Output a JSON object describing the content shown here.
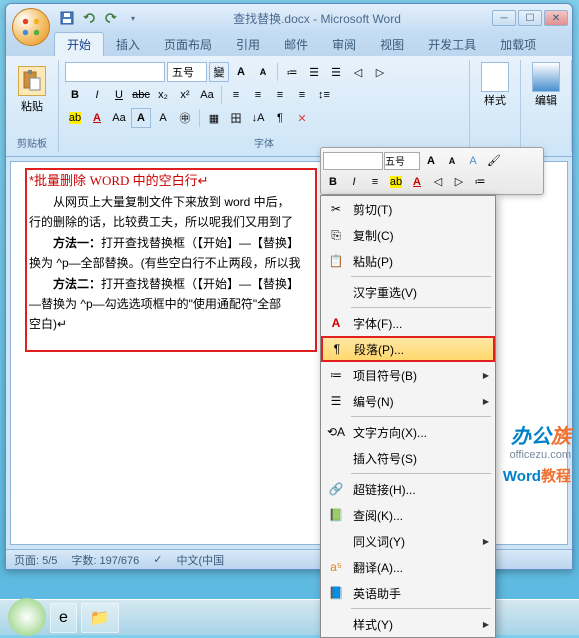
{
  "window": {
    "title": "查找替换.docx - Microsoft Word"
  },
  "tabs": {
    "t0": "开始",
    "t1": "插入",
    "t2": "页面布局",
    "t3": "引用",
    "t4": "邮件",
    "t5": "审阅",
    "t6": "视图",
    "t7": "开发工具",
    "t8": "加载项"
  },
  "ribbon": {
    "paste": "粘贴",
    "clipboard": "剪贴板",
    "font_size": "五号",
    "font_group": "字体",
    "styles": "样式",
    "editing": "编辑"
  },
  "mini": {
    "font": "",
    "size": "五号"
  },
  "doc": {
    "title_l": "*批量删除 ",
    "title_w": "WORD ",
    "title_r": "中的空白行↵",
    "p1a": "从网页上大量复制文件下来放到 word 中后，",
    "p1b": "行的删除的话，比较费工夫，所以呢我们又用到了",
    "m1": "方法一：",
    "m1a": "打开查找替换框（【开始】—【替换】",
    "m1b": "换为 ^p—全部替换。(有些空白行不止两段，所以我",
    "m2": "方法二：",
    "m2a": "打开查找替换框（【开始】—【替换】",
    "m2b": "—替换为 ^p—勾选选项框中的\"使用通配符\"全部",
    "m2c": "空白)↵"
  },
  "menu": {
    "cut": "剪切(T)",
    "copy": "复制(C)",
    "paste": "粘贴(P)",
    "hanzi": "汉字重选(V)",
    "font": "字体(F)...",
    "paragraph": "段落(P)...",
    "bullets": "项目符号(B)",
    "numbering": "编号(N)",
    "textdir": "文字方向(X)...",
    "symbol": "插入符号(S)",
    "hyperlink": "超链接(H)...",
    "lookup": "查阅(K)...",
    "synonyms": "同义词(Y)",
    "translate": "翻译(A)...",
    "english": "英语助手",
    "styles": "样式(Y)"
  },
  "status": {
    "page": "页面: 5/5",
    "words": "字数: 197/676",
    "lang": "中文(中国"
  },
  "watermark": {
    "brand_l": "办公",
    "brand_r": "族",
    "url": "officezu.com",
    "prod_l": "Word",
    "prod_r": "教程"
  }
}
